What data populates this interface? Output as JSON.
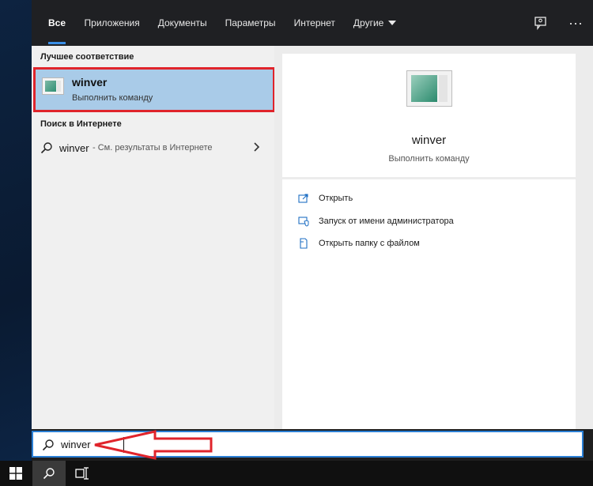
{
  "tabs": [
    {
      "label": "Все",
      "active": true
    },
    {
      "label": "Приложения"
    },
    {
      "label": "Документы"
    },
    {
      "label": "Параметры"
    },
    {
      "label": "Интернет"
    },
    {
      "label": "Другие",
      "has_dropdown": true
    }
  ],
  "topbar_icons": [
    "feedback-icon",
    "more-options-icon"
  ],
  "more_label": "···",
  "best_match": {
    "heading": "Лучшее соответствие",
    "title": "winver",
    "subtitle": "Выполнить команду",
    "highlight_color": "#e0242b"
  },
  "web_search": {
    "heading": "Поиск в Интернете",
    "term": "winver",
    "hint": "- См. результаты в Интернете"
  },
  "preview": {
    "title": "winver",
    "subtitle": "Выполнить команду"
  },
  "actions": [
    {
      "label": "Открыть",
      "icon": "open-icon"
    },
    {
      "label": "Запуск от имени администратора",
      "icon": "run-as-admin-icon"
    },
    {
      "label": "Открыть папку с файлом",
      "icon": "open-file-location-icon"
    }
  ],
  "search": {
    "value": "winver"
  },
  "colors": {
    "accent": "#3a8ee6",
    "selection": "#a9cbe8",
    "annotation_red": "#e0242b"
  },
  "taskbar": [
    "start-icon",
    "search-icon",
    "task-view-icon"
  ]
}
